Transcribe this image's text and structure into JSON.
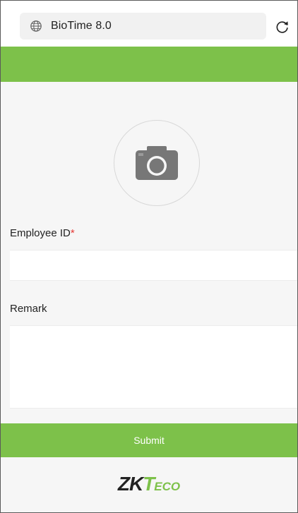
{
  "browser": {
    "address_text": "BioTime 8.0"
  },
  "form": {
    "employee_id_label": "Employee ID",
    "employee_id_required_mark": "*",
    "employee_id_value": "",
    "remark_label": "Remark",
    "remark_value": "",
    "submit_label": "Submit"
  },
  "brand": {
    "logo_zk": "ZK",
    "logo_t": "T",
    "logo_eco": "ECO"
  },
  "colors": {
    "accent": "#7dc14a",
    "required": "#e53935",
    "background": "#f6f6f6"
  },
  "icons": {
    "address": "globe-icon",
    "reload": "reload-icon",
    "photo": "camera-icon"
  }
}
